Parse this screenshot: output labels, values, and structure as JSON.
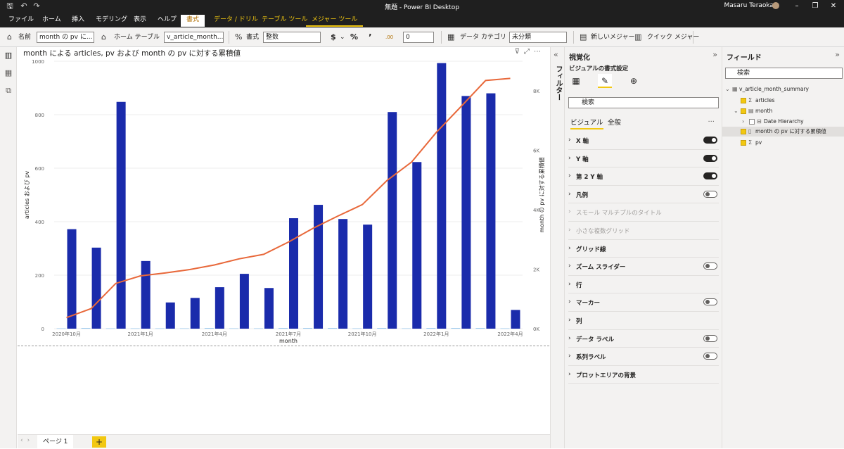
{
  "window": {
    "title": "無題 - Power BI Desktop",
    "user": "Masaru Teraoka"
  },
  "tabs": [
    "ファイル",
    "ホーム",
    "挿入",
    "モデリング",
    "表示",
    "ヘルプ",
    "書式",
    "データ / ドリル",
    "テーブル ツール",
    "メジャー ツール"
  ],
  "ribbon": {
    "name_label": "名前",
    "name_value": "month の pv に...",
    "home_table_label": "ホーム テーブル",
    "home_table_value": "v_article_month...",
    "format_label": "書式",
    "format_value": "整数",
    "currency": "$",
    "percent": "%",
    "comma": "’",
    "decimal_icon": ".00",
    "decimals_value": "0",
    "data_category_label": "データ カテゴリ",
    "data_category_value": "未分類",
    "new_measure": "新しいメジャー",
    "quick_measure": "クイック メジャー"
  },
  "visual": {
    "title": "month による articles, pv および month の pv に対する累積値"
  },
  "chart_data": {
    "type": "bar",
    "x_ticks": [
      "2020年10月",
      "2021年1月",
      "2021年4月",
      "2021年7月",
      "2021年10月",
      "2022年1月",
      "2022年4月"
    ],
    "x_tick_month_index": [
      0,
      3,
      6,
      9,
      12,
      15,
      18
    ],
    "xlabel": "month",
    "ylabel_left": "articles および pv",
    "ylabel_right": "month の pv に対する累積値",
    "y_left_ticks": [
      "0",
      "200",
      "400",
      "600",
      "800",
      "1000"
    ],
    "y_right_ticks": [
      "0K",
      "2K",
      "4K",
      "6K",
      "8K"
    ],
    "ylim_left": [
      0,
      1000
    ],
    "ylim_right": [
      0,
      9000
    ],
    "months": 19,
    "series": [
      {
        "name": "articles",
        "type": "bar",
        "color": "#7db9e8",
        "values": [
          1,
          2,
          1,
          1,
          1,
          1,
          2,
          1,
          1,
          2,
          2,
          2,
          1,
          2,
          1,
          2,
          2,
          2,
          1
        ]
      },
      {
        "name": "pv",
        "type": "bar",
        "color": "#1a2bab",
        "values": [
          372,
          303,
          848,
          253,
          98,
          115,
          155,
          205,
          152,
          413,
          463,
          410,
          389,
          810,
          623,
          993,
          870,
          880,
          70
        ]
      },
      {
        "name": "month の pv に対する累積値",
        "type": "line",
        "color": "#e8683a",
        "values": [
          372,
          675,
          1523,
          1776,
          1874,
          1989,
          2144,
          2349,
          2501,
          2914,
          3377,
          3787,
          4176,
          4986,
          5609,
          6602,
          7472,
          8352,
          8422
        ]
      }
    ]
  },
  "pages": {
    "tab": "ページ 1",
    "add": "+"
  },
  "filter_label": "フィルター",
  "viz_pane": {
    "title": "視覚化",
    "subtitle": "ビジュアルの書式設定",
    "search_placeholder": "検索",
    "subtabs": [
      "ビジュアル",
      "全般"
    ],
    "more": "...",
    "sections": [
      {
        "label": "X 軸",
        "toggle": "on"
      },
      {
        "label": "Y 軸",
        "toggle": "on"
      },
      {
        "label": "第 2 Y 軸",
        "toggle": "on"
      },
      {
        "label": "凡例",
        "toggle": "off"
      },
      {
        "label": "スモール マルチプルのタイトル",
        "toggle": "none",
        "dim": true
      },
      {
        "label": "小さな複数グリッド",
        "toggle": "none",
        "dim": true
      },
      {
        "label": "グリッド線",
        "toggle": "none"
      },
      {
        "label": "ズーム スライダー",
        "toggle": "off"
      },
      {
        "label": "行",
        "toggle": "none"
      },
      {
        "label": "マーカー",
        "toggle": "off"
      },
      {
        "label": "列",
        "toggle": "none"
      },
      {
        "label": "データ ラベル",
        "toggle": "off"
      },
      {
        "label": "系列ラベル",
        "toggle": "off"
      },
      {
        "label": "プロットエリアの背景",
        "toggle": "none"
      }
    ]
  },
  "fields_pane": {
    "title": "フィールド",
    "search_placeholder": "検索",
    "items": [
      {
        "label": "v_article_month_summary",
        "level": 0,
        "kind": "table"
      },
      {
        "label": "articles",
        "level": 1,
        "kind": "sigma",
        "checked": true
      },
      {
        "label": "month",
        "level": 1,
        "kind": "calendar",
        "checked": true
      },
      {
        "label": "Date Hierarchy",
        "level": 2,
        "kind": "hierarchy",
        "checked": false
      },
      {
        "label": "month の pv に対する累積値",
        "level": 1,
        "kind": "measure",
        "checked": true,
        "selected": true
      },
      {
        "label": "pv",
        "level": 1,
        "kind": "sigma",
        "checked": true
      }
    ]
  }
}
